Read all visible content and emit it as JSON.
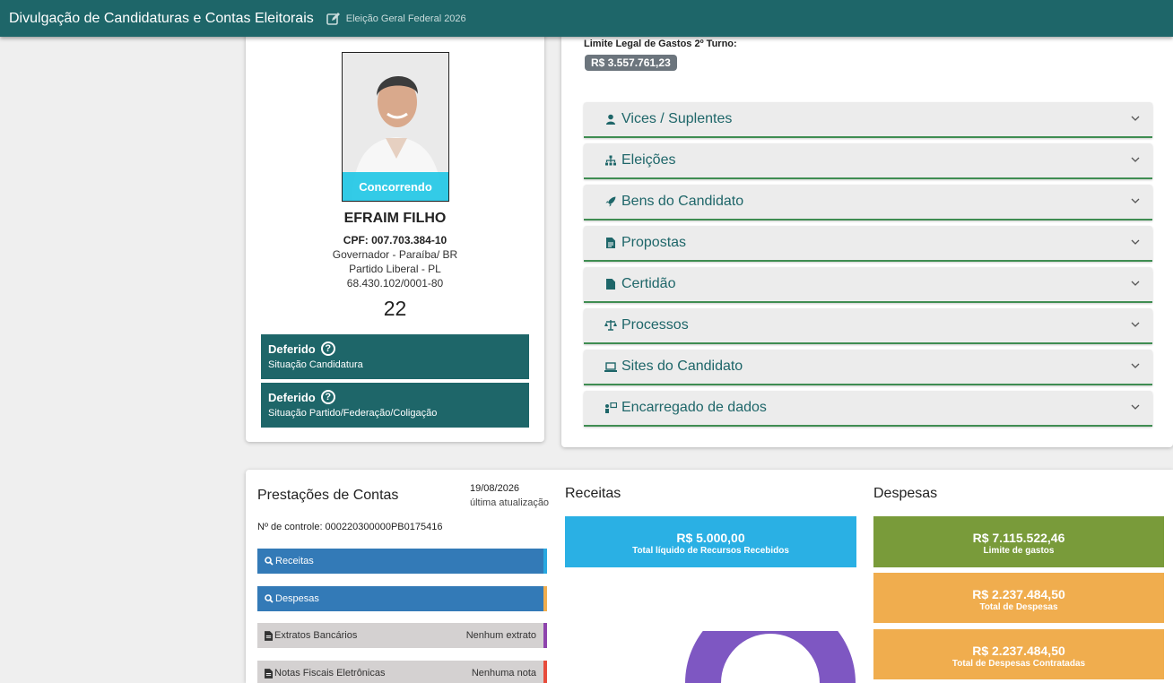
{
  "header": {
    "title": "Divulgação de Candidaturas e Contas Eleitorais",
    "election": "Eleição Geral Federal 2026"
  },
  "candidate": {
    "photo_badge": "Concorrendo",
    "name": "EFRAIM FILHO",
    "cpf": "CPF: 007.703.384-10",
    "office": "Governador - Paraíba/ BR",
    "party": "Partido Liberal - PL",
    "cnpj": "68.430.102/0001-80",
    "number": "22",
    "status_candidacy": {
      "value": "Deferido",
      "label": "Situação Candidatura"
    },
    "status_party": {
      "value": "Deferido",
      "label": "Situação Partido/Federação/Coligação"
    }
  },
  "spending": {
    "limit_label": "Limite Legal de Gastos 2º Turno:",
    "limit_value": "R$ 3.557.761,23"
  },
  "accordion": [
    {
      "label": "Vices / Suplentes",
      "icon": "person-icon"
    },
    {
      "label": "Eleições",
      "icon": "sitemap-icon"
    },
    {
      "label": "Bens do Candidato",
      "icon": "rocket-icon"
    },
    {
      "label": "Propostas",
      "icon": "document-icon"
    },
    {
      "label": "Certidão",
      "icon": "file-icon"
    },
    {
      "label": "Processos",
      "icon": "scales-icon"
    },
    {
      "label": "Sites do Candidato",
      "icon": "laptop-icon"
    },
    {
      "label": "Encarregado de dados",
      "icon": "data-officer-icon"
    }
  ],
  "accounts": {
    "title": "Prestações de Contas",
    "date": "19/08/2026",
    "updated": "última atualização",
    "control": "Nº de controle: 000220300000PB0175416",
    "rows": [
      {
        "label": "Receitas",
        "right": ""
      },
      {
        "label": "Despesas",
        "right": ""
      },
      {
        "label": "Extratos Bancários",
        "right": "Nenhum extrato"
      },
      {
        "label": "Notas Fiscais Eletrônicas",
        "right": "Nenhuma nota"
      }
    ],
    "colors": {
      "primary": "#1e6669",
      "blue": "#337ab7",
      "green": "#3f8d52"
    }
  },
  "receitas": {
    "title": "Receitas",
    "value": "R$ 5.000,00",
    "label": "Total líquido de Recursos Recebidos"
  },
  "despesas": {
    "title": "Despesas",
    "tiles": [
      {
        "value": "R$ 7.115.522,46",
        "label": "Limite de gastos"
      },
      {
        "value": "R$ 2.237.484,50",
        "label": "Total de Despesas"
      },
      {
        "value": "R$ 2.237.484,50",
        "label": "Total de Despesas Contratadas"
      }
    ]
  }
}
